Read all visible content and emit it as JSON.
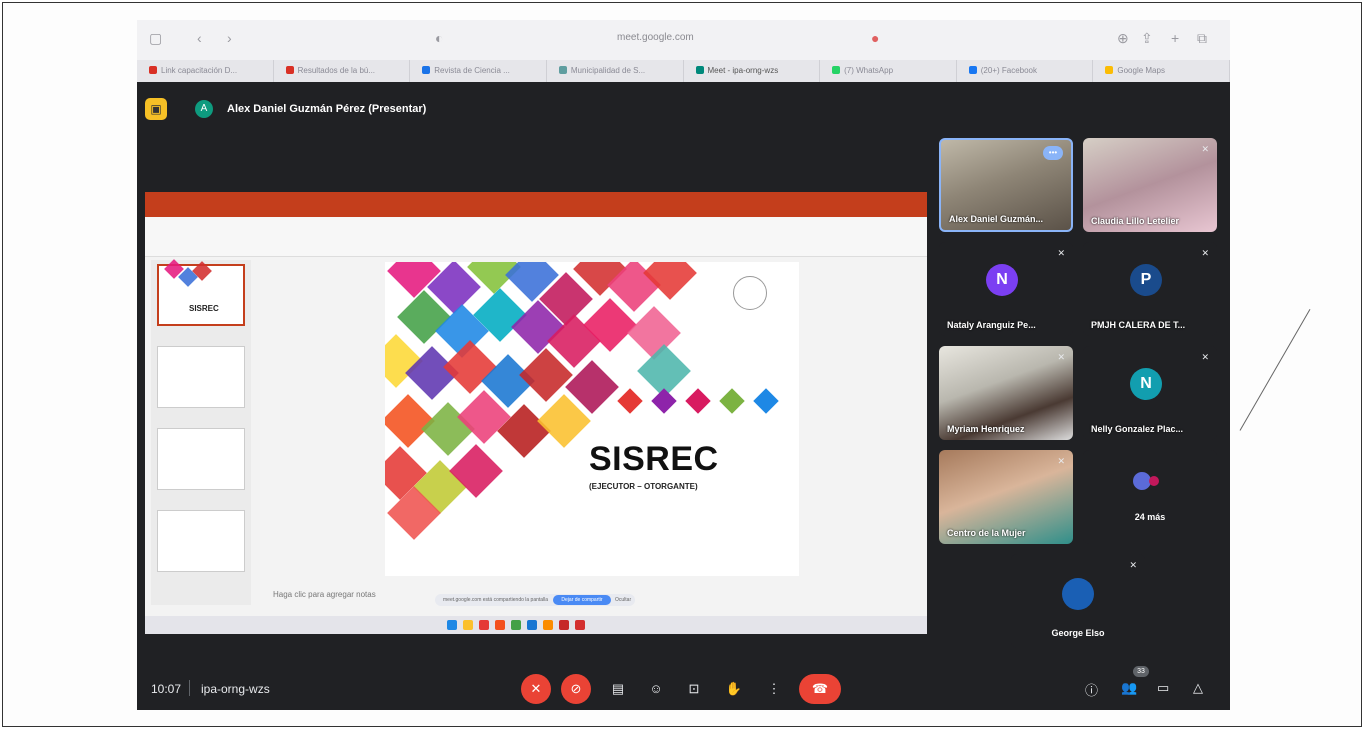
{
  "browser": {
    "url": "meet.google.com",
    "bookmarks": [
      {
        "label": "Link capacitación D...",
        "color": "#d93025"
      },
      {
        "label": "Resultados de la bú...",
        "color": "#d93025"
      },
      {
        "label": "Revista de Ciencia ...",
        "color": "#1a73e8"
      },
      {
        "label": "Municipalidad de S...",
        "color": "#5f9ea0"
      },
      {
        "label": "Meet - ipa-orng-wzs",
        "color": "#00897b"
      },
      {
        "label": "(7) WhatsApp",
        "color": "#25d366"
      },
      {
        "label": "(20+) Facebook",
        "color": "#1877f2"
      },
      {
        "label": "Google Maps",
        "color": "#fbbc04"
      }
    ]
  },
  "meet": {
    "presenter_initial": "A",
    "presenter_label": "Alex Daniel Guzmán Pérez (Presentar)",
    "time": "10:07",
    "meeting_code": "ipa-orng-wzs",
    "participant_count": "33",
    "more_badge": "•••"
  },
  "slide": {
    "title": "SISREC",
    "subtitle": "(EJECUTOR – OTORGANTE)",
    "thumb_title": "SISREC",
    "notes_placeholder": "Haga clic para agregar notas",
    "share_text": "meet.google.com está compartiendo la pantalla",
    "share_stop": "Dejar de compartir",
    "share_hide": "Ocultar"
  },
  "participants": [
    {
      "name": "Alex Daniel Guzmán...",
      "initial": "",
      "avatar_color": ""
    },
    {
      "name": "Claudia Lillo Letelier",
      "initial": "",
      "avatar_color": ""
    },
    {
      "name": "Nataly Aranguiz Pe...",
      "initial": "N",
      "avatar_color": "#7b3ff2"
    },
    {
      "name": "PMJH CALERA DE T...",
      "initial": "P",
      "avatar_color": "#1a4b8c"
    },
    {
      "name": "Myriam Henriquez",
      "initial": "",
      "avatar_color": ""
    },
    {
      "name": "Nelly Gonzalez Plac...",
      "initial": "N",
      "avatar_color": "#129eaf"
    },
    {
      "name": "Centro de la Mujer",
      "initial": "",
      "avatar_color": ""
    },
    {
      "name": "24 más",
      "initial": "",
      "avatar_color": ""
    },
    {
      "name": "George Elso",
      "initial": "",
      "avatar_color": "#1a5fb4"
    }
  ]
}
